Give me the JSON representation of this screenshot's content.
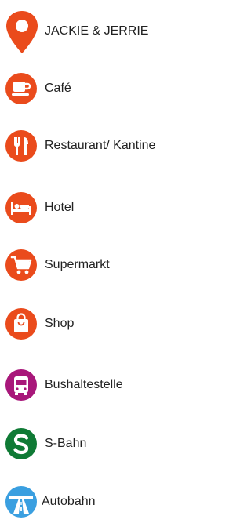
{
  "legend": {
    "items": [
      {
        "label": "JACKIE & JERRIE",
        "icon": "location-pin-icon",
        "color": "#ea4b1c"
      },
      {
        "label": "Café",
        "icon": "coffee-cup-icon",
        "color": "#ea4b1c"
      },
      {
        "label": "Restaurant/ Kantine",
        "icon": "fork-knife-icon",
        "color": "#ea4b1c"
      },
      {
        "label": "Hotel",
        "icon": "bed-icon",
        "color": "#ea4b1c"
      },
      {
        "label": "Supermarkt",
        "icon": "shopping-cart-icon",
        "color": "#ea4b1c"
      },
      {
        "label": "Shop",
        "icon": "shopping-bag-icon",
        "color": "#ea4b1c"
      },
      {
        "label": "Bushaltestelle",
        "icon": "bus-icon",
        "color": "#a8177a"
      },
      {
        "label": "S-Bahn",
        "icon": "s-bahn-icon",
        "color": "#0f7a35"
      },
      {
        "label": "Autobahn",
        "icon": "autobahn-icon",
        "color": "#3a9fe0"
      }
    ]
  }
}
